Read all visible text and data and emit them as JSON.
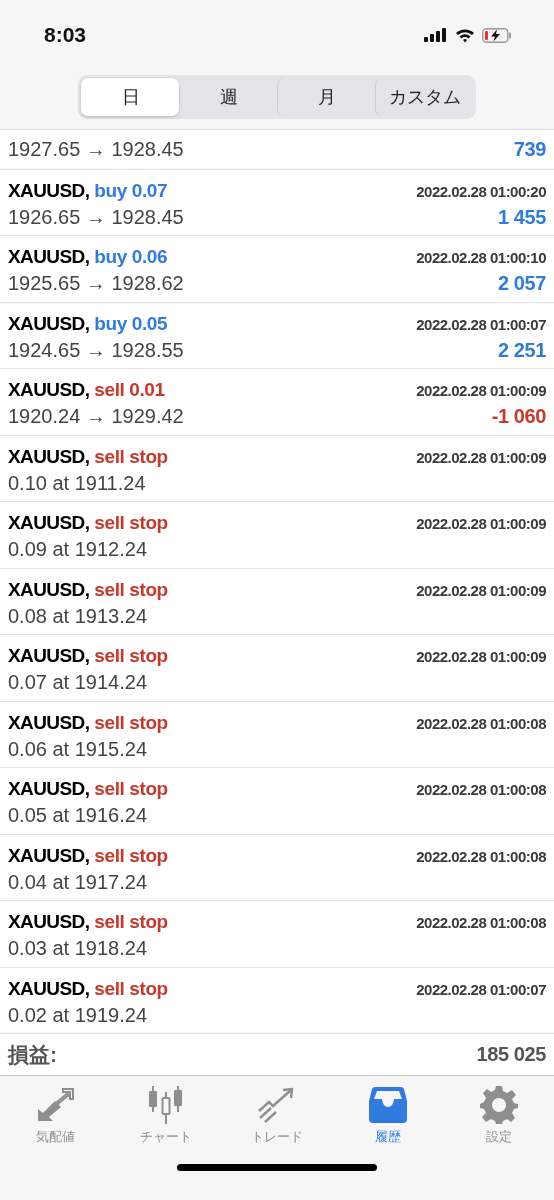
{
  "status_bar": {
    "time": "8:03"
  },
  "period_tabs": [
    {
      "label": "日",
      "selected": true
    },
    {
      "label": "週",
      "selected": false
    },
    {
      "label": "月",
      "selected": false
    },
    {
      "label": "カスタム",
      "selected": false
    }
  ],
  "partial_row": {
    "prices": "1927.65 → 1928.45",
    "profit": "739",
    "loss": false
  },
  "rows": [
    {
      "kind": "deal",
      "symbol": "XAUUSD,",
      "action": "buy 0.07",
      "sell": false,
      "time": "2022.02.28 01:00:20",
      "prices": "1926.65 → 1928.45",
      "profit": "1 455",
      "loss": false
    },
    {
      "kind": "deal",
      "symbol": "XAUUSD,",
      "action": "buy 0.06",
      "sell": false,
      "time": "2022.02.28 01:00:10",
      "prices": "1925.65 → 1928.62",
      "profit": "2 057",
      "loss": false
    },
    {
      "kind": "deal",
      "symbol": "XAUUSD,",
      "action": "buy 0.05",
      "sell": false,
      "time": "2022.02.28 01:00:07",
      "prices": "1924.65 → 1928.55",
      "profit": "2 251",
      "loss": false
    },
    {
      "kind": "deal",
      "symbol": "XAUUSD,",
      "action": "sell 0.01",
      "sell": true,
      "time": "2022.02.28 01:00:09",
      "prices": "1920.24 → 1929.42",
      "profit": "-1 060",
      "loss": true
    },
    {
      "kind": "order",
      "symbol": "XAUUSD,",
      "action": "sell stop",
      "sell": true,
      "time": "2022.02.28 01:00:09",
      "prices": "0.10 at 1911.24"
    },
    {
      "kind": "order",
      "symbol": "XAUUSD,",
      "action": "sell stop",
      "sell": true,
      "time": "2022.02.28 01:00:09",
      "prices": "0.09 at 1912.24"
    },
    {
      "kind": "order",
      "symbol": "XAUUSD,",
      "action": "sell stop",
      "sell": true,
      "time": "2022.02.28 01:00:09",
      "prices": "0.08 at 1913.24"
    },
    {
      "kind": "order",
      "symbol": "XAUUSD,",
      "action": "sell stop",
      "sell": true,
      "time": "2022.02.28 01:00:09",
      "prices": "0.07 at 1914.24"
    },
    {
      "kind": "order",
      "symbol": "XAUUSD,",
      "action": "sell stop",
      "sell": true,
      "time": "2022.02.28 01:00:08",
      "prices": "0.06 at 1915.24"
    },
    {
      "kind": "order",
      "symbol": "XAUUSD,",
      "action": "sell stop",
      "sell": true,
      "time": "2022.02.28 01:00:08",
      "prices": "0.05 at 1916.24"
    },
    {
      "kind": "order",
      "symbol": "XAUUSD,",
      "action": "sell stop",
      "sell": true,
      "time": "2022.02.28 01:00:08",
      "prices": "0.04 at 1917.24"
    },
    {
      "kind": "order",
      "symbol": "XAUUSD,",
      "action": "sell stop",
      "sell": true,
      "time": "2022.02.28 01:00:08",
      "prices": "0.03 at 1918.24"
    },
    {
      "kind": "order",
      "symbol": "XAUUSD,",
      "action": "sell stop",
      "sell": true,
      "time": "2022.02.28 01:00:07",
      "prices": "0.02 at 1919.24"
    }
  ],
  "summary": {
    "label": "損益:",
    "value": "185 025"
  },
  "bottom_tabs": [
    {
      "kind": "quotes",
      "label": "気配値",
      "selected": false
    },
    {
      "kind": "chart",
      "label": "チャート",
      "selected": false
    },
    {
      "kind": "trade",
      "label": "トレード",
      "selected": false
    },
    {
      "kind": "history",
      "label": "履歴",
      "selected": true
    },
    {
      "kind": "settings",
      "label": "設定",
      "selected": false
    }
  ]
}
